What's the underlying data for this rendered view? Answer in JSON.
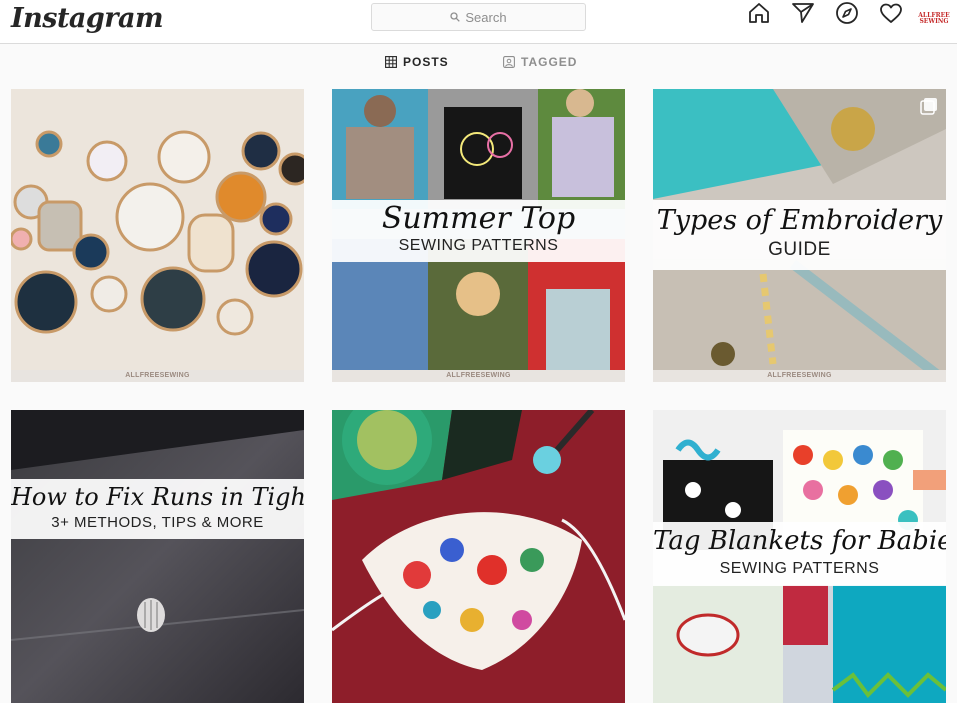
{
  "header": {
    "logo": "Instagram",
    "search_placeholder": "Search",
    "avatar_text_line1": "ALLFREE",
    "avatar_text_line2": "SEWING"
  },
  "tabs": [
    {
      "label": "POSTS",
      "active": true
    },
    {
      "label": "TAGGED",
      "active": false
    }
  ],
  "posts": [
    {
      "title": "",
      "subtitle": "",
      "brand": "ALLFREESEWING",
      "image": "embroidery-hoops-wall"
    },
    {
      "title": "Summer Top",
      "subtitle": "SEWING PATTERNS",
      "brand": "ALLFREESEWING",
      "image": "summer-tops-collage"
    },
    {
      "title": "Types of Embroidery",
      "subtitle": "GUIDE",
      "brand": "ALLFREESEWING",
      "image": "embroidery-stitches",
      "multiple": true
    },
    {
      "title": "How to Fix Runs in Tights",
      "subtitle": "3+ METHODS, TIPS & MORE",
      "brand": "",
      "image": "tights-closeup"
    },
    {
      "title": "",
      "subtitle": "",
      "brand": "",
      "image": "floral-face-mask"
    },
    {
      "title": "Tag Blankets for Babies",
      "subtitle": "SEWING PATTERNS",
      "brand": "",
      "image": "tag-blankets-collage"
    }
  ],
  "colors": {
    "background": "#fafafa",
    "border": "#dbdbdb",
    "muted": "#8e8e8e",
    "text": "#262626"
  }
}
